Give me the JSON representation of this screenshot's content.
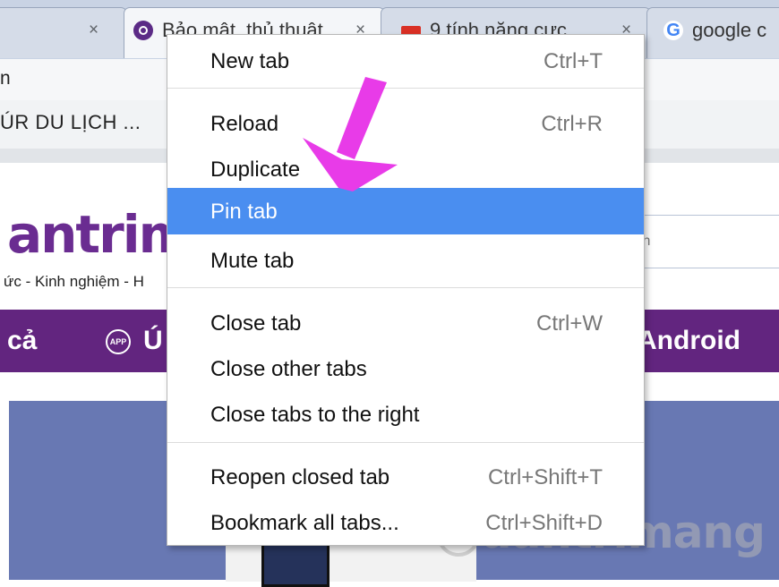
{
  "tabs": [
    {
      "title": "",
      "close": "×"
    },
    {
      "title": "Bảo mật, thủ thuật",
      "close": "×"
    },
    {
      "title": "9 tính năng cực",
      "close": "×"
    },
    {
      "title": "google c"
    }
  ],
  "omnibox": {
    "text": "n"
  },
  "bookmarks": {
    "item": "ÚR DU LỊCH ..."
  },
  "page": {
    "logo": "antrima",
    "tagline": "ức - Kinh nghiệm - H",
    "search_placeholder": "ìh",
    "nav": {
      "item1": "cả",
      "app_badge": "APP",
      "item2": "Ú",
      "item3": "Android"
    },
    "watermark": "uantrimang"
  },
  "context_menu": {
    "items": [
      {
        "label": "New tab",
        "shortcut": "Ctrl+T"
      },
      {
        "label": "Reload",
        "shortcut": "Ctrl+R"
      },
      {
        "label": "Duplicate",
        "shortcut": ""
      },
      {
        "label": "Pin tab",
        "shortcut": ""
      },
      {
        "label": "Mute tab",
        "shortcut": ""
      },
      {
        "label": "Close tab",
        "shortcut": "Ctrl+W"
      },
      {
        "label": "Close other tabs",
        "shortcut": ""
      },
      {
        "label": "Close tabs to the right",
        "shortcut": ""
      },
      {
        "label": "Reopen closed tab",
        "shortcut": "Ctrl+Shift+T"
      },
      {
        "label": "Bookmark all tabs...",
        "shortcut": "Ctrl+Shift+D"
      }
    ],
    "highlighted": "Pin tab"
  },
  "colors": {
    "menu_highlight": "#4a8ef0",
    "brand_purple": "#62257f",
    "arrow": "#e83be8"
  },
  "icons": [
    "close-icon",
    "quantrimang-favicon",
    "news-favicon",
    "google-favicon",
    "app-icon",
    "arrow-annotation-icon"
  ]
}
